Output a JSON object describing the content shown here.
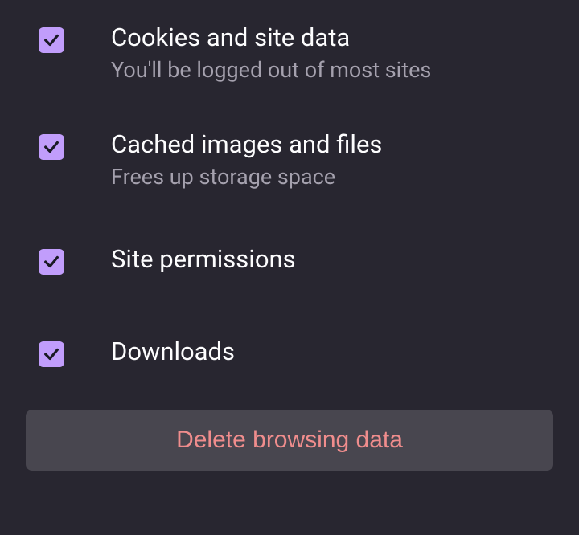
{
  "options": {
    "cookies": {
      "title": "Cookies and site data",
      "subtitle": "You'll be logged out of most sites",
      "checked": true
    },
    "cache": {
      "title": "Cached images and files",
      "subtitle": "Frees up storage space",
      "checked": true
    },
    "permissions": {
      "title": "Site permissions",
      "checked": true
    },
    "downloads": {
      "title": "Downloads",
      "checked": true
    }
  },
  "action": {
    "delete_label": "Delete browsing data"
  },
  "colors": {
    "background": "#282630",
    "checkbox": "#c19dfb",
    "text_primary": "#fdfdfe",
    "text_secondary": "#a5a1ae",
    "button_bg": "#48464f",
    "button_text": "#f08d8d"
  }
}
